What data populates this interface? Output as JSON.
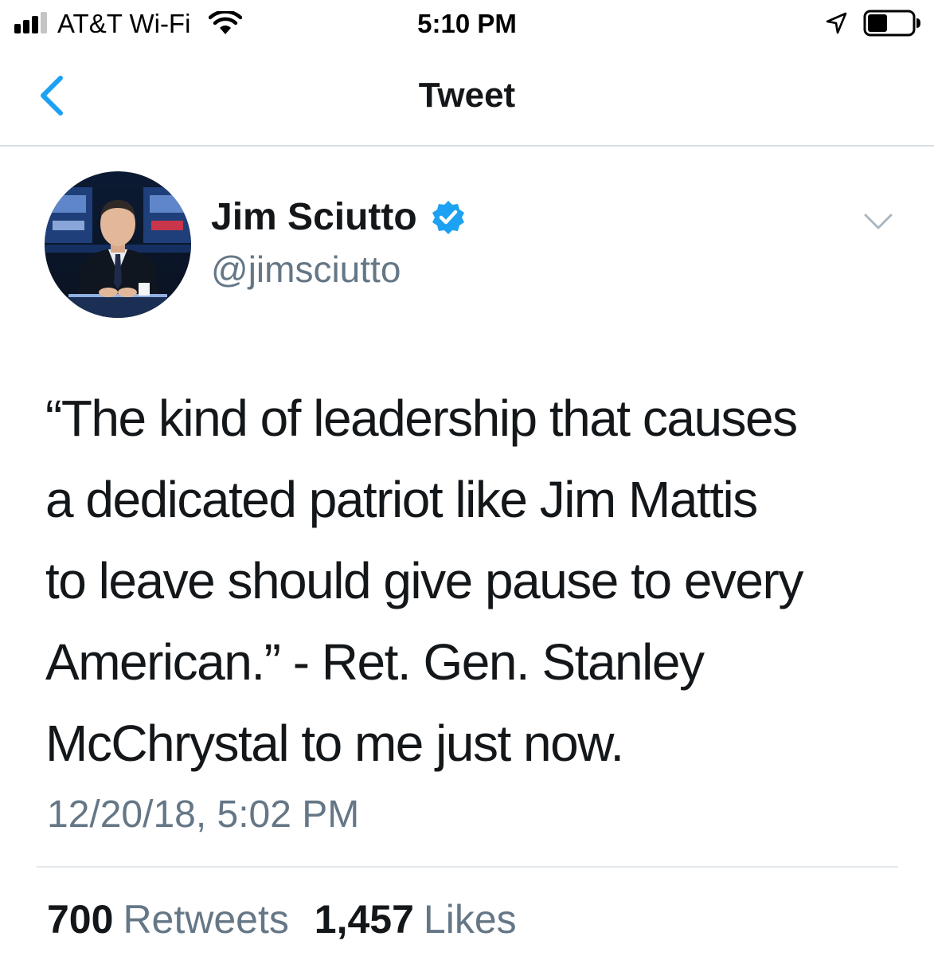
{
  "status_bar": {
    "carrier": "AT&T Wi-Fi",
    "time": "5:10 PM",
    "signal_bars": 4,
    "signal_bars_active": 3,
    "battery_level": 0.45
  },
  "nav": {
    "title": "Tweet"
  },
  "tweet": {
    "author": {
      "name": "Jim Sciutto",
      "handle": "@jimsciutto",
      "verified": true
    },
    "text": "“The kind of leadership that causes\na dedicated patriot like Jim Mattis\nto leave should give pause to every\nAmerican.” - Ret. Gen. Stanley\nMcChrystal to me just now.",
    "timestamp": "12/20/18, 5:02 PM",
    "stats": {
      "retweets_count": "700",
      "retweets_label": "Retweets",
      "likes_count": "1,457",
      "likes_label": "Likes"
    }
  },
  "colors": {
    "accent": "#1da1f2",
    "text_primary": "#14171a",
    "text_secondary": "#657786",
    "divider": "#e1e8ed"
  },
  "icons": {
    "back": "chevron-left-icon",
    "verified": "verified-badge-icon",
    "menu": "chevron-down-icon",
    "wifi": "wifi-icon",
    "location": "location-arrow-icon",
    "battery": "battery-icon"
  }
}
